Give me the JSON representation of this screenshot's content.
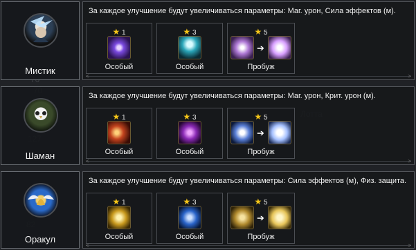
{
  "classes": [
    {
      "name": "Мистик",
      "icon": "mystic-portrait-icon",
      "description": "За каждое улучшение будут увеличиваться параметры: Маг. урон, Сила эффектов (м).",
      "skills": [
        {
          "stars": "1",
          "label": "Особый",
          "icon": "purple-orb-icon"
        },
        {
          "stars": "3",
          "label": "Особый",
          "icon": "cyan-spirit-icon"
        },
        {
          "stars": "5",
          "label": "Пробуж",
          "icon": "burst-upgrade-icon"
        }
      ],
      "colors": {
        "s1": "#6a3fd1",
        "s2": "#2aa5b8",
        "s3a": "#b07ad6",
        "s3b": "#d8a0ff"
      }
    },
    {
      "name": "Шаман",
      "icon": "owl-portrait-icon",
      "description": "За каждое улучшение будут увеличиваться параметры: Маг. урон, Крит. урон (м).",
      "skills": [
        {
          "stars": "1",
          "label": "Особый",
          "icon": "fire-orbs-icon"
        },
        {
          "stars": "3",
          "label": "Особый",
          "icon": "violet-demon-icon"
        },
        {
          "stars": "5",
          "label": "Пробуж",
          "icon": "light-wings-icon"
        }
      ],
      "colors": {
        "s1": "#c2431e",
        "s2": "#8a2ab5",
        "s3a": "#5a7fd6",
        "s3b": "#a6c1ff"
      }
    },
    {
      "name": "Оракул",
      "icon": "bell-wings-portrait-icon",
      "description": "За каждое улучшение будут увеличиваться параметры: Сила эффектов (м), Физ. защита.",
      "skills": [
        {
          "stars": "1",
          "label": "Особый",
          "icon": "golden-sphere-icon"
        },
        {
          "stars": "3",
          "label": "Особый",
          "icon": "blue-rings-icon"
        },
        {
          "stars": "5",
          "label": "Пробуж",
          "icon": "golden-dancer-icon"
        }
      ],
      "colors": {
        "s1": "#c99a1e",
        "s2": "#2a64c9",
        "s3a": "#b18a2e",
        "s3b": "#e7c55a"
      }
    }
  ],
  "accent": {
    "star": "#f5c518",
    "border": "#6b6f75"
  }
}
